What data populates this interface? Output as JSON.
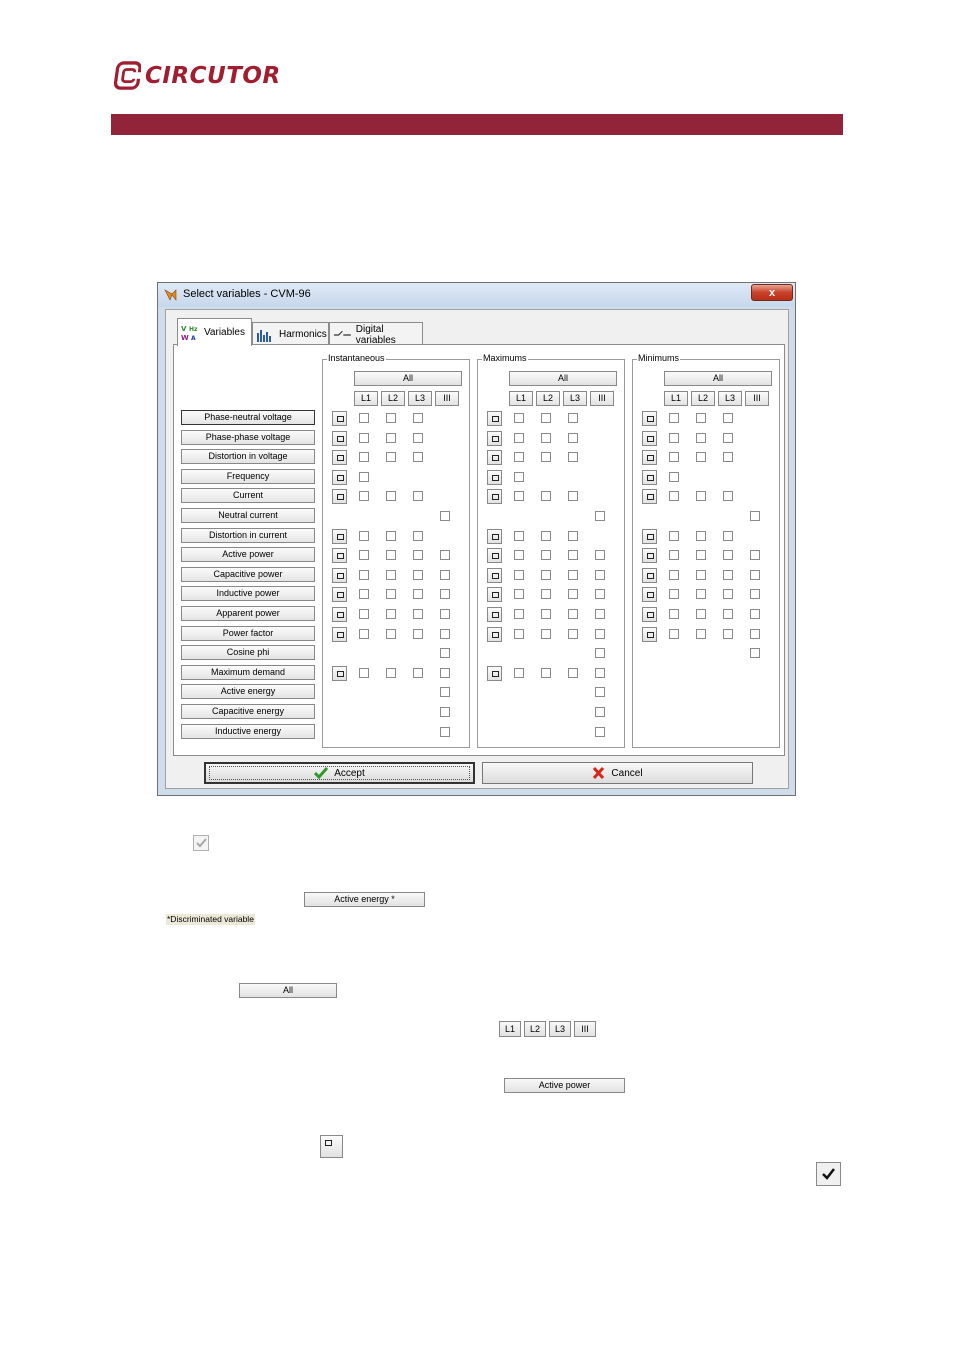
{
  "brand": {
    "logo_text": "CIRCUTOR",
    "bar_color": "#92243a",
    "logo_color": "#a01e2f"
  },
  "dialog": {
    "title": "Select  variables - CVM-96",
    "close_label": "x",
    "tabs": [
      {
        "label": "Variables",
        "icon": "variables-icon",
        "active": true
      },
      {
        "label": "Harmonics",
        "icon": "harmonics-icon",
        "active": false
      },
      {
        "label": "Digital variables",
        "icon": "digital-icon",
        "active": false
      }
    ],
    "variables": [
      "Phase-neutral voltage",
      "Phase-phase voltage",
      "Distortion in voltage",
      "Frequency",
      "Current",
      "Neutral current",
      "Distortion in current",
      "Active power",
      "Capacitive power",
      "Inductive power",
      "Apparent power",
      "Power factor",
      "Cosine phi",
      "Maximum demand",
      "Active energy",
      "Capacitive energy",
      "Inductive energy"
    ],
    "groups": [
      {
        "label": "Instantaneous",
        "all_label": "All",
        "phase_labels": [
          "L1",
          "L2",
          "L3",
          "III"
        ]
      },
      {
        "label": "Maximums",
        "all_label": "All",
        "phase_labels": [
          "L1",
          "L2",
          "L3",
          "III"
        ]
      },
      {
        "label": "Minimums",
        "all_label": "All",
        "phase_labels": [
          "L1",
          "L2",
          "L3",
          "III"
        ]
      }
    ],
    "accept_label": "Accept",
    "cancel_label": "Cancel"
  },
  "legend": {
    "active_energy_button": "Active energy *",
    "discriminated_note": "*Discriminated variable",
    "all_button": "All",
    "phase_buttons": [
      "L1",
      "L2",
      "L3",
      "III"
    ],
    "active_power_button": "Active power"
  }
}
